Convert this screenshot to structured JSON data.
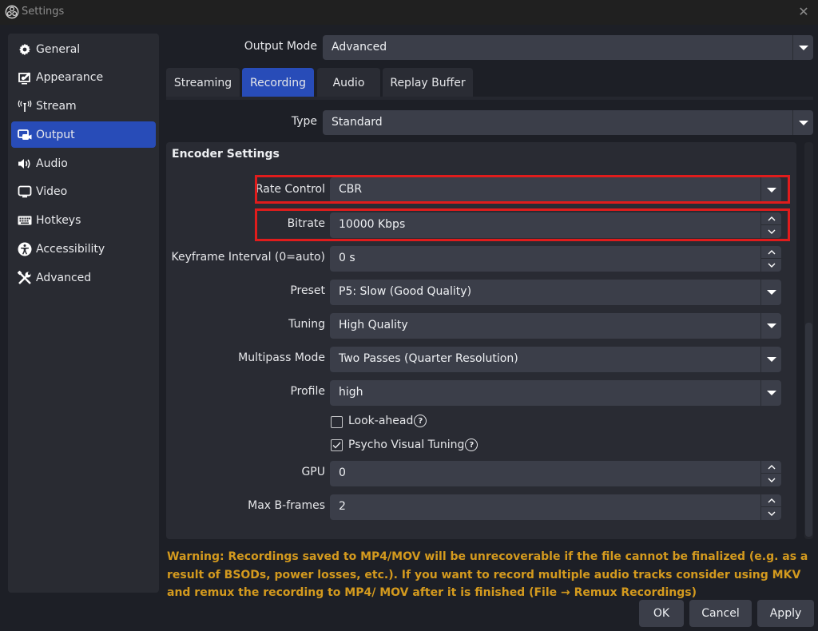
{
  "window": {
    "title": "Settings",
    "app_icon": "obs-logo-icon",
    "close_icon": "close-icon"
  },
  "sidebar": {
    "items": [
      {
        "label": "General",
        "icon": "gear-icon",
        "active": false
      },
      {
        "label": "Appearance",
        "icon": "appearance-icon",
        "active": false
      },
      {
        "label": "Stream",
        "icon": "antenna-icon",
        "active": false
      },
      {
        "label": "Output",
        "icon": "output-icon",
        "active": true
      },
      {
        "label": "Audio",
        "icon": "speaker-icon",
        "active": false
      },
      {
        "label": "Video",
        "icon": "monitor-icon",
        "active": false
      },
      {
        "label": "Hotkeys",
        "icon": "keyboard-icon",
        "active": false
      },
      {
        "label": "Accessibility",
        "icon": "accessibility-icon",
        "active": false
      },
      {
        "label": "Advanced",
        "icon": "tools-icon",
        "active": false
      }
    ]
  },
  "output_mode": {
    "label": "Output Mode",
    "value": "Advanced"
  },
  "tabs": [
    {
      "label": "Streaming",
      "active": false
    },
    {
      "label": "Recording",
      "active": true
    },
    {
      "label": "Audio",
      "active": false
    },
    {
      "label": "Replay Buffer",
      "active": false
    }
  ],
  "type": {
    "label": "Type",
    "value": "Standard"
  },
  "encoder": {
    "title": "Encoder Settings",
    "rate_control": {
      "label": "Rate Control",
      "value": "CBR"
    },
    "bitrate": {
      "label": "Bitrate",
      "value": "10000 Kbps"
    },
    "keyframe": {
      "label": "Keyframe Interval (0=auto)",
      "value": "0 s"
    },
    "preset": {
      "label": "Preset",
      "value": "P5: Slow (Good Quality)"
    },
    "tuning": {
      "label": "Tuning",
      "value": "High Quality"
    },
    "multipass": {
      "label": "Multipass Mode",
      "value": "Two Passes (Quarter Resolution)"
    },
    "profile": {
      "label": "Profile",
      "value": "high"
    },
    "lookahead": {
      "label": "Look-ahead",
      "checked": false,
      "help": "?"
    },
    "psycho": {
      "label": "Psycho Visual Tuning",
      "checked": true,
      "help": "?"
    },
    "gpu": {
      "label": "GPU",
      "value": "0"
    },
    "bframes": {
      "label": "Max B-frames",
      "value": "2"
    }
  },
  "warning": "Warning: Recordings saved to MP4/MOV will be unrecoverable if the file cannot be finalized (e.g. as a result of BSODs, power losses, etc.). If you want to record multiple audio tracks consider using MKV and remux the recording to MP4/ MOV after it is finished (File → Remux Recordings)",
  "buttons": {
    "ok": "OK",
    "cancel": "Cancel",
    "apply": "Apply"
  },
  "colors": {
    "accent": "#284cb8",
    "highlight_box": "#e01c1c",
    "warning_text": "#d49a1e"
  }
}
